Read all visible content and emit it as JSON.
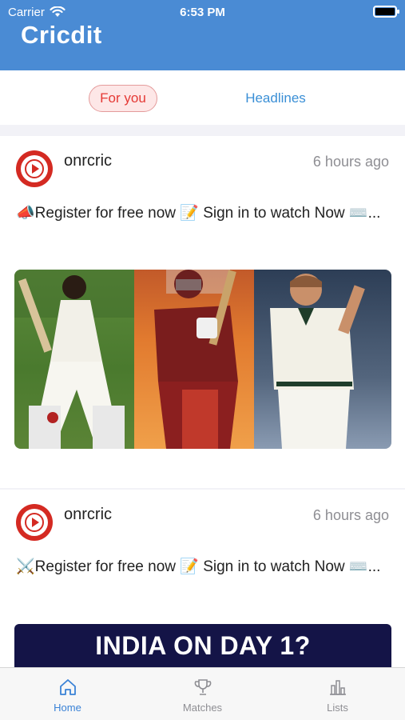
{
  "status_bar": {
    "carrier": "Carrier",
    "time": "6:53 PM"
  },
  "header": {
    "title": "Cricdit"
  },
  "tabs": [
    {
      "label": "For you",
      "active": true
    },
    {
      "label": "Headlines",
      "active": false
    }
  ],
  "posts": [
    {
      "user": "onrcric",
      "time_ago": "6 hours ago",
      "text": "📣Register for free now 📝 Sign in to watch Now ⌨️...",
      "icon": "cricket-ball-icon"
    },
    {
      "user": "onrcric",
      "time_ago": "6 hours ago",
      "text": "⚔️Register for free now 📝 Sign in to watch Now ⌨️...",
      "banner": "INDIA ON DAY 1?"
    }
  ],
  "bottom_tabs": [
    {
      "label": "Home",
      "icon": "home-icon",
      "active": true
    },
    {
      "label": "Matches",
      "icon": "trophy-icon",
      "active": false
    },
    {
      "label": "Lists",
      "icon": "list-icon",
      "active": false
    }
  ],
  "colors": {
    "header": "#4a8bd4",
    "accent_red": "#e53935",
    "link_blue": "#3a8fd6",
    "banner_bg": "#141447"
  }
}
